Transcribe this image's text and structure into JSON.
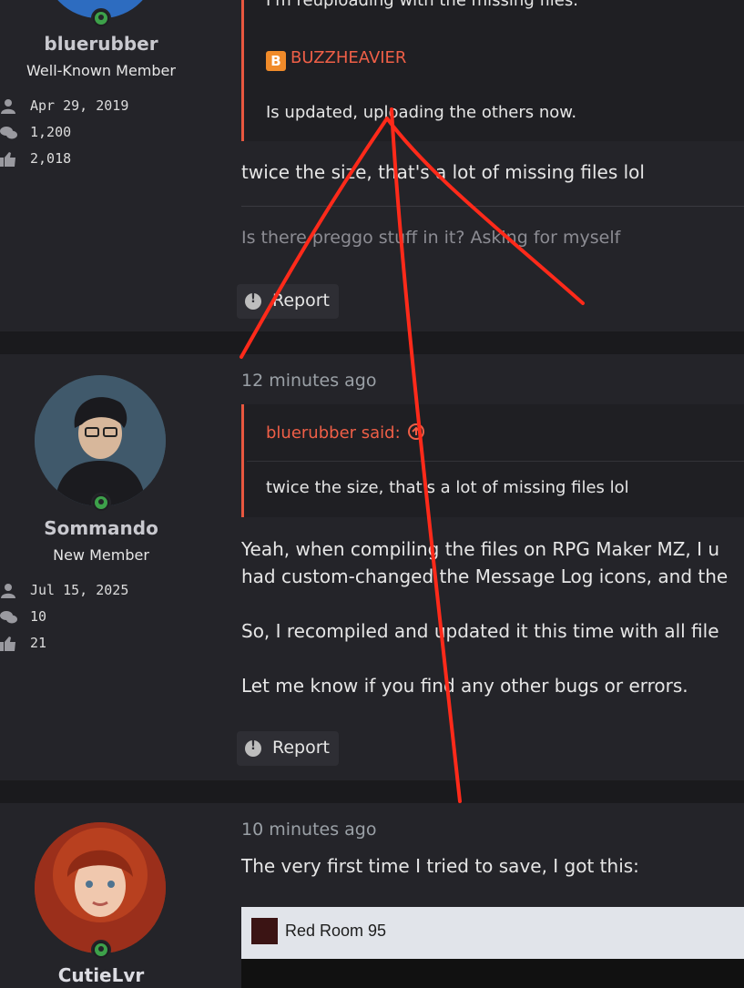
{
  "posts": [
    {
      "user": {
        "name": "bluerubber",
        "title": "Well-Known Member",
        "joined": "Apr 29, 2019",
        "messages": "1,200",
        "reactions": "2,018"
      },
      "quote_lines": [
        "I'm reuploading with the missing files.",
        "BUZZHEAVIER",
        "Is updated, uploading the others now."
      ],
      "body": [
        "twice the size, that's a lot of missing files lol"
      ],
      "muted": "Is there preggo stuff in it? Asking for myself",
      "report": "Report"
    },
    {
      "time": "12 minutes ago",
      "user": {
        "name": "Sommando",
        "title": "New Member",
        "joined": "Jul 15, 2025",
        "messages": "10",
        "reactions": "21"
      },
      "quote_author": "bluerubber said:",
      "quote_text": "twice the size, that's a lot of missing files lol",
      "body": [
        "Yeah, when compiling the files on RPG Maker MZ, I u",
        "had custom-changed the Message Log icons, and the",
        "So, I recompiled and updated it this time with all file",
        "Let me know if you find any other bugs or errors."
      ],
      "report": "Report"
    },
    {
      "time": "10 minutes ago",
      "user": {
        "name": "CutieLvr"
      },
      "body": [
        "The very first time I tried to save, I got this:"
      ],
      "embed_title": "Red Room 95"
    }
  ],
  "colors": {
    "accent": "#e8573f",
    "online": "#3da14a",
    "annotation": "#ff2a1a"
  },
  "icons": [
    "user-icon",
    "messages-icon",
    "thumbs-up-icon",
    "alert-icon",
    "quote-up-icon",
    "buzzheavier-icon"
  ]
}
